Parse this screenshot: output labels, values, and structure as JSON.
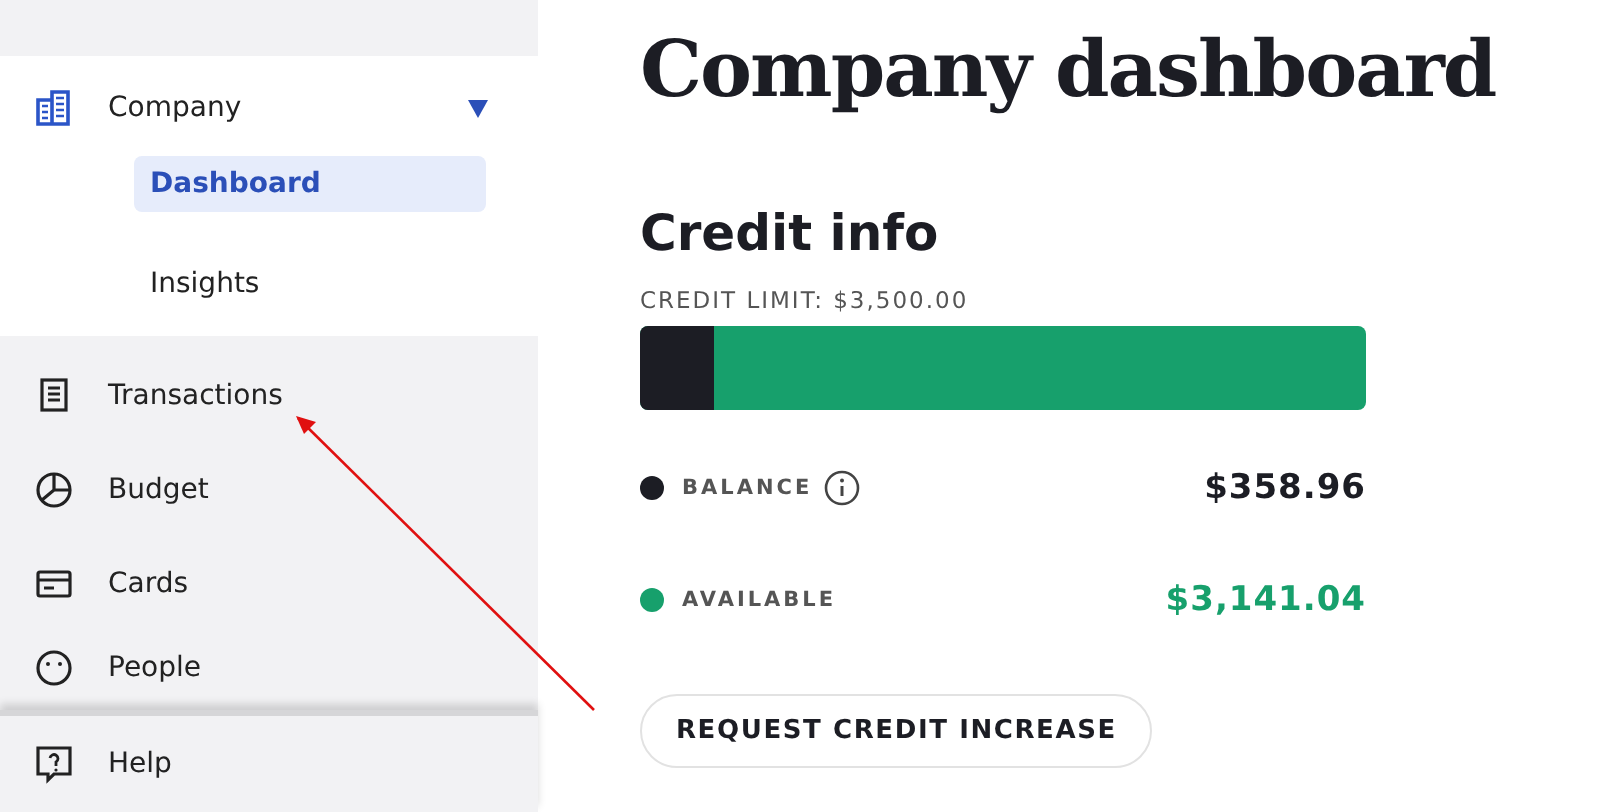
{
  "sidebar": {
    "section": {
      "label": "Company",
      "expanded": true,
      "children": [
        {
          "label": "Dashboard",
          "selected": true
        },
        {
          "label": "Insights",
          "selected": false
        }
      ]
    },
    "items": [
      {
        "label": "Transactions"
      },
      {
        "label": "Budget"
      },
      {
        "label": "Cards"
      },
      {
        "label": "People"
      }
    ],
    "footer": {
      "label": "Help"
    }
  },
  "main": {
    "title": "Company dashboard",
    "credit": {
      "heading": "Credit info",
      "limit": "CREDIT LIMIT: $3,500.00",
      "level": 0.1026,
      "segments": [
        {
          "label": "BALANCE",
          "amount": "$358.96",
          "color": "#1c1d24",
          "info": true
        },
        {
          "label": "AVAILABLE",
          "amount": "$3,141.04",
          "color": "#17a06c"
        }
      ],
      "button": "REQUEST CREDIT INCREASE"
    }
  }
}
